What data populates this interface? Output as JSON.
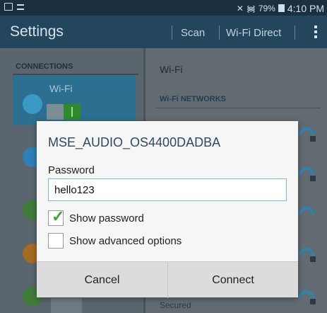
{
  "status_bar": {
    "battery": "79%",
    "time": "4:10 PM"
  },
  "action_bar": {
    "title": "Settings",
    "scan": "Scan",
    "wifi_direct": "Wi-Fi Direct",
    "more_icon": "overflow-menu-icon"
  },
  "left_pane": {
    "section": "CONNECTIONS",
    "wifi_label": "Wi-Fi",
    "wifi_toggle": "on"
  },
  "right_pane": {
    "title": "Wi-Fi",
    "section": "Wi-Fi NETWORKS",
    "bottom_label": "Secured"
  },
  "dialog": {
    "title": "MSE_AUDIO_OS4400DADBA",
    "password_label": "Password",
    "password_value": "hello123",
    "show_password_label": "Show password",
    "show_password_checked": true,
    "show_advanced_label": "Show advanced options",
    "show_advanced_checked": false,
    "cancel_label": "Cancel",
    "connect_label": "Connect"
  },
  "colors": {
    "action_bar": "#23465d",
    "accent": "#2e84b0",
    "check": "#39a832"
  }
}
